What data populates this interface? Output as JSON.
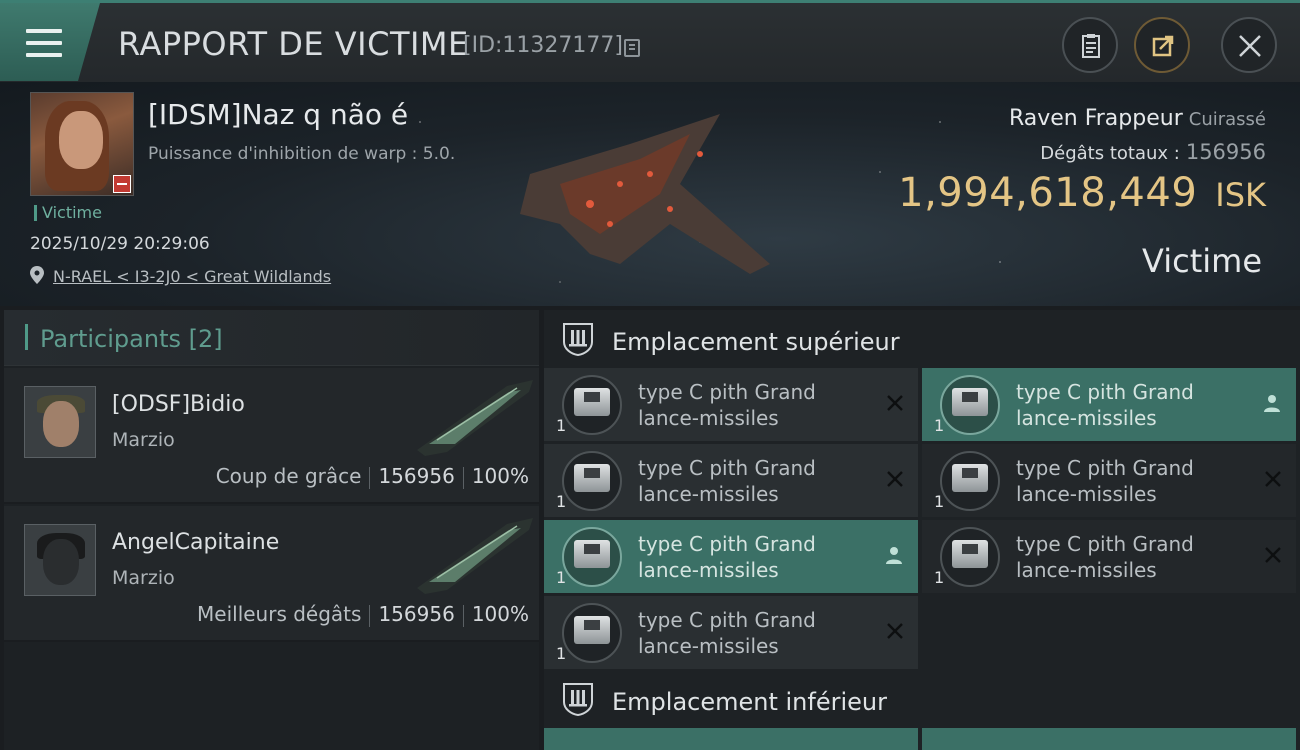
{
  "header": {
    "title": "RAPPORT DE VICTIME",
    "report_id": "[ID:11327177]"
  },
  "victim": {
    "name": "[IDSM]Naz q não é",
    "subtitle": "Puissance d'inhibition de warp : 5.0.",
    "tag": "Victime",
    "datetime": "2025/10/29 20:29:06",
    "location": "N-RAEL < I3-2J0 < Great Wildlands"
  },
  "summary": {
    "ship_name": "Raven Frappeur",
    "ship_class": "Cuirassé",
    "damage_label": "Dégâts totaux :",
    "damage_value": "156956",
    "isk_value": "1,994,618,449",
    "isk_unit": "ISK",
    "role": "Victime"
  },
  "participants": {
    "label": "Participants",
    "count": "[2]",
    "items": [
      {
        "name": "[ODSF]Bidio",
        "ship": "Marzio",
        "role": "Coup de grâce",
        "damage": "156956",
        "percent": "100%"
      },
      {
        "name": "AngelCapitaine",
        "ship": "Marzio",
        "role": "Meilleurs dégâts",
        "damage": "156956",
        "percent": "100%"
      }
    ]
  },
  "slots": {
    "upper_label": "Emplacement supérieur",
    "lower_label": "Emplacement inférieur",
    "items": [
      {
        "line1": "type C pith Grand",
        "line2": "lance-missiles",
        "qty": "1",
        "state": "destroyed",
        "active": false
      },
      {
        "line1": "type C pith Grand",
        "line2": "lance-missiles",
        "qty": "1",
        "state": "dropped",
        "active": true
      },
      {
        "line1": "type C pith Grand",
        "line2": "lance-missiles",
        "qty": "1",
        "state": "destroyed",
        "active": false
      },
      {
        "line1": "type C pith Grand",
        "line2": "lance-missiles",
        "qty": "1",
        "state": "destroyed",
        "active": false
      },
      {
        "line1": "type C pith Grand",
        "line2": "lance-missiles",
        "qty": "1",
        "state": "dropped",
        "active": true
      },
      {
        "line1": "type C pith Grand",
        "line2": "lance-missiles",
        "qty": "1",
        "state": "destroyed",
        "active": false
      },
      {
        "line1": "type C pith Grand",
        "line2": "lance-missiles",
        "qty": "1",
        "state": "destroyed",
        "active": false
      }
    ]
  },
  "colors": {
    "accent": "#3b7066",
    "isk": "#e4c585",
    "victim_badge": "#c23a32"
  },
  "icons": [
    "menu-icon",
    "copy-icon",
    "clipboard-icon",
    "share-icon",
    "close-icon",
    "location-pin-icon",
    "slot-high-icon",
    "slot-low-icon",
    "close-x-icon",
    "user-icon"
  ]
}
